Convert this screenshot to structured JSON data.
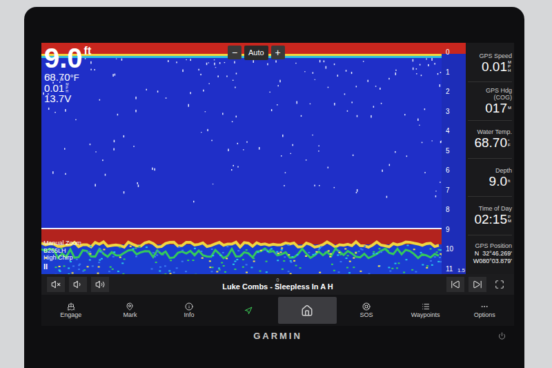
{
  "overlay": {
    "depth": "9.0",
    "depth_unit": "ft",
    "water_temp": "68.70",
    "temp_unit": "°F",
    "speed": "0.01",
    "speed_unit": "MPH",
    "voltage": "13.7V"
  },
  "zoom": {
    "minus": "−",
    "mode": "Auto",
    "plus": "+"
  },
  "sonar_info": {
    "zoom": "Manual Zoom",
    "transducer": "B265LH",
    "frequency": "High Chirp",
    "pause": "II"
  },
  "sonar": {
    "bottom_level": 0.8
  },
  "scale": {
    "ticks": [
      "0",
      "1",
      "2",
      "3",
      "4",
      "5",
      "6",
      "7",
      "8",
      "9",
      "10",
      "11"
    ],
    "range": "1.5"
  },
  "data_fields": [
    {
      "label": "GPS Speed",
      "value": "0.01",
      "unit": "MPH"
    },
    {
      "label": "GPS Hdg (COG)",
      "value": "017",
      "unit": "M"
    },
    {
      "label": "Water Temp.",
      "value": "68.70",
      "unit": "°F"
    },
    {
      "label": "Depth",
      "value": "9.0",
      "unit": "ft"
    },
    {
      "label": "Time of Day",
      "value": "02:15",
      "unit": "PM"
    }
  ],
  "gps_position": {
    "label": "GPS Position",
    "lines": [
      "N  32°46.269'",
      "W080°03.879'"
    ]
  },
  "media": {
    "volume": "0",
    "track": "Luke Combs - Sleepless In A H"
  },
  "nav": [
    {
      "label": "Engage",
      "highlighted": false
    },
    {
      "label": "Mark",
      "highlighted": false
    },
    {
      "label": "Info",
      "highlighted": false
    },
    {
      "label": "",
      "highlighted": false
    },
    {
      "label": "",
      "highlighted": true
    },
    {
      "label": "SOS",
      "highlighted": false
    },
    {
      "label": "Waypoints",
      "highlighted": false
    },
    {
      "label": "Options",
      "highlighted": false
    }
  ],
  "brand": "GARMIN"
}
